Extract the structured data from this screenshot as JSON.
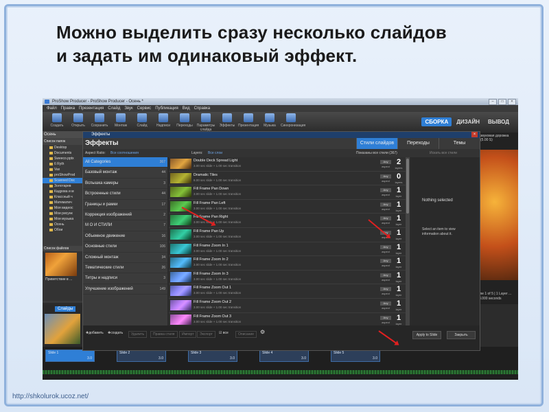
{
  "slide": {
    "headline_line1": "Можно выделить сразу  несколько слайдов",
    "headline_line2": "и задать им одинаковый эффект.",
    "footer_url": "http://shkolurok.ucoz.net/"
  },
  "app": {
    "title": "ProShow Producer - ProShow Producer - Осень *",
    "menu": [
      "Файл",
      "Правка",
      "Презентация",
      "Слайд",
      "Звук",
      "Сервис",
      "Публикация",
      "Вид",
      "Справка"
    ],
    "toolbar": [
      "Создать",
      "Открыть",
      "Сохранить",
      "Монтаж",
      "Слайд",
      "Надписи",
      "Переходы",
      "Параметры слайда",
      "Эффекты",
      "Презентация",
      "Музыка",
      "Синхронизация"
    ],
    "modes": [
      "СБОРКА",
      "ДИЗАЙН",
      "ВЫВОД"
    ],
    "folder_title": "Осень",
    "folders_header": "Список папок",
    "folders": [
      "Desktop",
      "Documents",
      "Sweeco.pptx",
      "6 Ryth",
      "Vax",
      "proShowProd",
      "Scanned Doc",
      "Золотарев",
      "Кадрова и м",
      "Классный ч",
      "Математич",
      "Моя видеос",
      "Мои рисунк",
      "Мои музыка",
      "Осень",
      "Обои"
    ],
    "files_header": "Список файлов",
    "file_name": "Приветствие в ...",
    "slides_tab": "Слайды",
    "preview_info": "me 1 of 5 | 1 Layer ... 8.000 seconds",
    "preview_header": "звуковая дорожка (5.00 S)",
    "timeline": [
      {
        "name": "Slide 1",
        "dur": "3.0"
      },
      {
        "name": "Slide 2",
        "dur": "3.0"
      },
      {
        "name": "Slide 3",
        "dur": "3.0"
      },
      {
        "name": "Slide 4",
        "dur": "3.0"
      },
      {
        "name": "Slide 5",
        "dur": "3.0"
      }
    ]
  },
  "dialog": {
    "window_title": "Эффекты",
    "heading": "Эффекты",
    "tabs": [
      "Стили слайдов",
      "Переходы",
      "Темы"
    ],
    "aspect_label": "Aspect Ratio:",
    "aspect_value": "Все соотношения",
    "layers_label": "Layers:",
    "layers_value": "Все слои",
    "shown": "Показаны все стили (367)",
    "search_placeholder": "Искать все стили",
    "categories": [
      {
        "name": "All Categories",
        "count": "367"
      },
      {
        "name": "Базовый монтаж",
        "count": "44"
      },
      {
        "name": "Вспышка камеры",
        "count": "3"
      },
      {
        "name": "Встроенные стили",
        "count": "44"
      },
      {
        "name": "Границы и рамки",
        "count": "17"
      },
      {
        "name": "Коррекция изображений",
        "count": "2"
      },
      {
        "name": "М О И   СТИЛИ",
        "count": "7"
      },
      {
        "name": "Объемное движение",
        "count": "16"
      },
      {
        "name": "Основные стили",
        "count": "106"
      },
      {
        "name": "Сложный монтаж",
        "count": "34"
      },
      {
        "name": "Тематические стили",
        "count": "26"
      },
      {
        "name": "Титры и надписи",
        "count": "3"
      },
      {
        "name": "Улучшение изображений",
        "count": "149"
      }
    ],
    "styles": [
      {
        "name": "Double Deck Spread Light",
        "sub": "3.00 sec slide + 1.00 sec transition",
        "any": "Any",
        "aspect": "aspect",
        "count": "2",
        "layers": "layers"
      },
      {
        "name": "Dramatic Tiles",
        "sub": "8.00 sec slide + 1.00 sec transition",
        "any": "Any",
        "aspect": "aspect",
        "count": "0",
        "layers": "layers"
      },
      {
        "name": "Fill Frame Pan Down",
        "sub": "3.00 sec slide + 1.00 sec transition",
        "any": "Any",
        "aspect": "aspect",
        "count": "1",
        "layers": "layer"
      },
      {
        "name": "Fill Frame Pan Left",
        "sub": "3.00 sec slide + 1.00 sec transition",
        "any": "Any",
        "aspect": "aspect",
        "count": "1",
        "layers": "layer"
      },
      {
        "name": "Fill Frame Pan Right",
        "sub": "3.00 sec slide + 1.00 sec transition",
        "any": "Any",
        "aspect": "aspect",
        "count": "1",
        "layers": "layer"
      },
      {
        "name": "Fill Frame Pan Up",
        "sub": "3.00 sec slide + 1.00 sec transition",
        "any": "Any",
        "aspect": "aspect",
        "count": "1",
        "layers": "layer"
      },
      {
        "name": "Fill Frame Zoom In 1",
        "sub": "3.00 sec slide + 1.00 sec transition",
        "any": "Any",
        "aspect": "aspect",
        "count": "1",
        "layers": "layer"
      },
      {
        "name": "Fill Frame Zoom In 2",
        "sub": "3.00 sec slide + 1.00 sec transition",
        "any": "Any",
        "aspect": "aspect",
        "count": "1",
        "layers": "layer"
      },
      {
        "name": "Fill Frame Zoom In 3",
        "sub": "3.00 sec slide + 1.00 sec transition",
        "any": "Any",
        "aspect": "aspect",
        "count": "1",
        "layers": "layer"
      },
      {
        "name": "Fill Frame Zoom Out 1",
        "sub": "3.00 sec slide + 1.00 sec transition",
        "any": "Any",
        "aspect": "aspect",
        "count": "1",
        "layers": "layer"
      },
      {
        "name": "Fill Frame Zoom Out 2",
        "sub": "3.00 sec slide + 1.00 sec transition",
        "any": "Any",
        "aspect": "aspect",
        "count": "1",
        "layers": "layer"
      },
      {
        "name": "Fill Frame Zoom Out 3",
        "sub": "3.00 sec slide + 1.00 sec transition",
        "any": "Any",
        "aspect": "aspect",
        "count": "1",
        "layers": "layer"
      }
    ],
    "nothing_selected": "Nothing selected",
    "info_help": "Select an item to view information about it.",
    "footer": {
      "add": "добавить",
      "create": "создать",
      "b1": "Удалить",
      "b2": "Правка стиля",
      "b3": "Импорт",
      "b4": "Экспорт",
      "all": "все",
      "b5": "Описание"
    },
    "apply": "Apply to Slide",
    "close": "Закрыть"
  },
  "colors": {
    "accent": "#2f7fd6",
    "arrow": "#e02020",
    "frame": "#8fb1dc"
  }
}
